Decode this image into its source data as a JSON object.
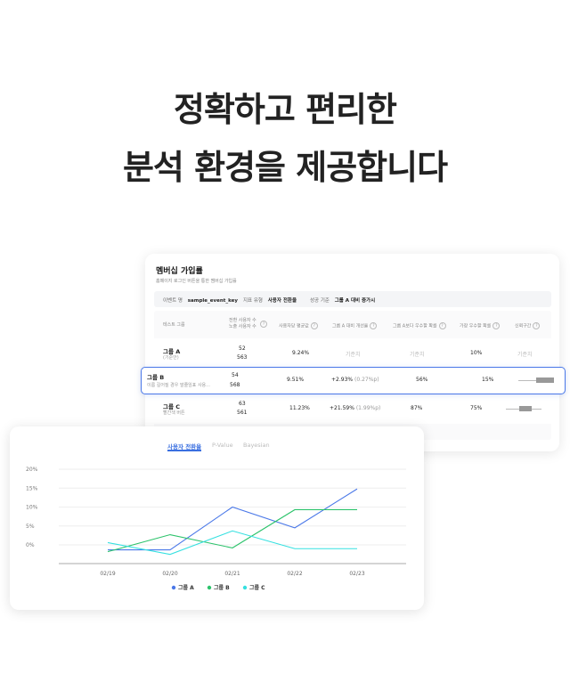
{
  "headline": {
    "line1": "정확하고 편리한",
    "line2": "분석 환경을 제공합니다"
  },
  "table_card": {
    "title": "멤버십 가입률",
    "subtitle": "홈페이지 로그인 버튼을 통한 멤버십 가입률",
    "filters": {
      "event_key_label": "이벤트 명",
      "event_key_value": "sample_event_key",
      "metric_type_label": "지표 유형",
      "metric_type_value": "사용자 전환율",
      "success_label": "성공 기준",
      "success_value": "그룹 A 대비 증가시"
    },
    "headers": [
      "테스트 그룹",
      "전환 사용자 수",
      "노출 사용자 수",
      "사용자당 평균값",
      "그룹 A 대비 개선율",
      "그룹 A보다 우수할 확률",
      "가장 우수할 확률",
      "신뢰구간"
    ],
    "rows": [
      {
        "name": "그룹 A",
        "desc": "(기준안)",
        "converted": "52",
        "exposed": "563",
        "avg": "9.24%",
        "improve": "기준치",
        "prob_better": "기준치",
        "prob_best": "10%",
        "ci": "기준치"
      },
      {
        "name": "그룹 B",
        "desc": "이름 길어질 경우 말줄임표 사용...",
        "converted": "54",
        "exposed": "568",
        "avg": "9.51%",
        "improve": "+2.93%",
        "improve_p": "(0.27%p)",
        "prob_better": "56%",
        "prob_best": "15%"
      },
      {
        "name": "그룹 C",
        "desc": "빨간색 버튼",
        "converted": "63",
        "exposed": "561",
        "avg": "11.23%",
        "improve": "+21.59%",
        "improve_p": "(1.99%p)",
        "prob_better": "87%",
        "prob_best": "75%"
      }
    ]
  },
  "chart_card": {
    "tabs": [
      "사용자 전환율",
      "P-Value",
      "Bayesian"
    ],
    "active_tab": 0
  },
  "colors": {
    "group_a": "#4a78e8",
    "group_b": "#2cc36b",
    "group_c": "#35e0e0",
    "accent": "#3a6fe0"
  },
  "chart_data": {
    "type": "line",
    "x": [
      "02/19",
      "02/20",
      "02/21",
      "02/22",
      "02/23"
    ],
    "yticks": [
      "20%",
      "15%",
      "10%",
      "5%",
      "0%"
    ],
    "ylim": [
      -5,
      20
    ],
    "series": [
      {
        "name": "그룹 A",
        "values": [
          -1.3,
          -1.3,
          10.0,
          4.5,
          14.8
        ]
      },
      {
        "name": "그룹 B",
        "values": [
          -1.8,
          2.7,
          -0.8,
          9.3,
          9.3
        ]
      },
      {
        "name": "그룹 C",
        "values": [
          0.6,
          -2.5,
          3.7,
          -1.0,
          -1.0
        ]
      }
    ]
  }
}
